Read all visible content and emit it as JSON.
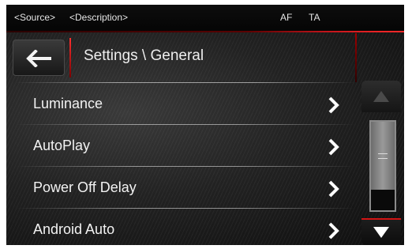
{
  "status_bar": {
    "source": "<Source>",
    "description": "<Description>",
    "af": "AF",
    "ta": "TA"
  },
  "header": {
    "back_icon": "left-arrow-icon",
    "title": "Settings \\ General"
  },
  "menu": {
    "items": [
      {
        "label": "Luminance",
        "icon": "chevron-right-icon"
      },
      {
        "label": "AutoPlay",
        "icon": "chevron-right-icon"
      },
      {
        "label": "Power Off Delay",
        "icon": "chevron-right-icon"
      },
      {
        "label": "Android Auto",
        "icon": "chevron-right-icon"
      }
    ]
  },
  "scrollbar": {
    "up_icon": "triangle-up-icon",
    "down_icon": "triangle-down-icon",
    "grip_icon": "grip-lines-icon",
    "position": 0.0,
    "up_enabled": false,
    "down_enabled": true
  },
  "colors": {
    "accent": "#d21414",
    "background": "#151515",
    "text": "#f2f2f2"
  }
}
